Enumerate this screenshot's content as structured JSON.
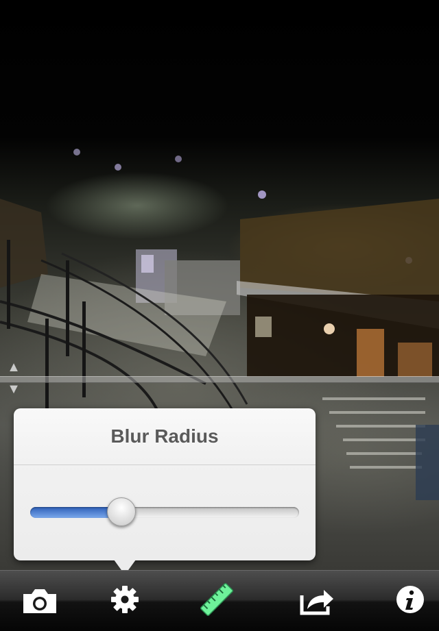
{
  "popover": {
    "title": "Blur Radius",
    "slider_value": 0.34
  },
  "focus_handles": {
    "up": "▲",
    "down": "▼"
  },
  "toolbar": {
    "items": [
      {
        "icon": "camera-icon"
      },
      {
        "icon": "gear-icon"
      },
      {
        "icon": "ruler-icon",
        "color": "#6ef29a"
      },
      {
        "icon": "share-icon"
      },
      {
        "icon": "info-icon"
      }
    ]
  },
  "colors": {
    "slider_fill": "#3f74d0",
    "ruler_green": "#6ef29a"
  }
}
